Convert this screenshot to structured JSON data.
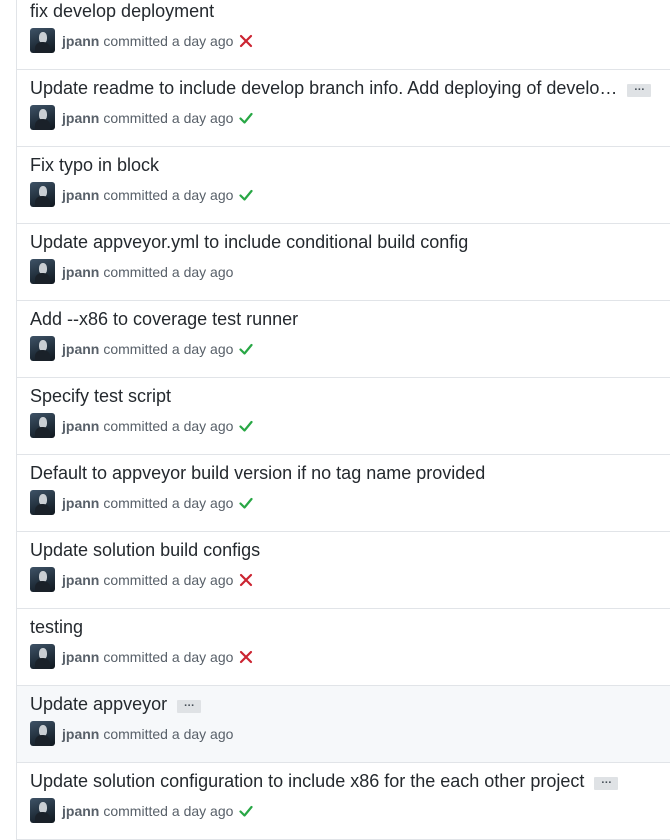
{
  "colors": {
    "success": "#28a745",
    "failure": "#cb2431",
    "border": "#e1e4e8",
    "highlight": "#f6f8fa"
  },
  "commits": [
    {
      "title": "fix develop deployment",
      "author": "jpann",
      "verb": "committed",
      "time": "a day ago",
      "status": "failure",
      "status_icon": "x-icon"
    },
    {
      "title": "Update readme to include develop branch info. Add deploying of develo…",
      "expand": "…",
      "author": "jpann",
      "verb": "committed",
      "time": "a day ago",
      "status": "success",
      "status_icon": "check-icon"
    },
    {
      "title": "Fix typo in block",
      "author": "jpann",
      "verb": "committed",
      "time": "a day ago",
      "status": "success",
      "status_icon": "check-icon"
    },
    {
      "title": "Update appveyor.yml to include conditional build config",
      "author": "jpann",
      "verb": "committed",
      "time": "a day ago",
      "status": "none"
    },
    {
      "title": "Add --x86 to coverage test runner",
      "author": "jpann",
      "verb": "committed",
      "time": "a day ago",
      "status": "success",
      "status_icon": "check-icon"
    },
    {
      "title": "Specify test script",
      "author": "jpann",
      "verb": "committed",
      "time": "a day ago",
      "status": "success",
      "status_icon": "check-icon"
    },
    {
      "title": "Default to appveyor build version if no tag name provided",
      "author": "jpann",
      "verb": "committed",
      "time": "a day ago",
      "status": "success",
      "status_icon": "check-icon"
    },
    {
      "title": "Update solution build configs",
      "author": "jpann",
      "verb": "committed",
      "time": "a day ago",
      "status": "failure",
      "status_icon": "x-icon"
    },
    {
      "title": "testing",
      "author": "jpann",
      "verb": "committed",
      "time": "a day ago",
      "status": "failure",
      "status_icon": "x-icon"
    },
    {
      "title": "Update appveyor",
      "expand": "…",
      "author": "jpann",
      "verb": "committed",
      "time": "a day ago",
      "status": "none",
      "highlighted": true
    },
    {
      "title": "Update solution configuration to include x86 for the each other project",
      "expand": "…",
      "author": "jpann",
      "verb": "committed",
      "time": "a day ago",
      "status": "success",
      "status_icon": "check-icon"
    }
  ]
}
